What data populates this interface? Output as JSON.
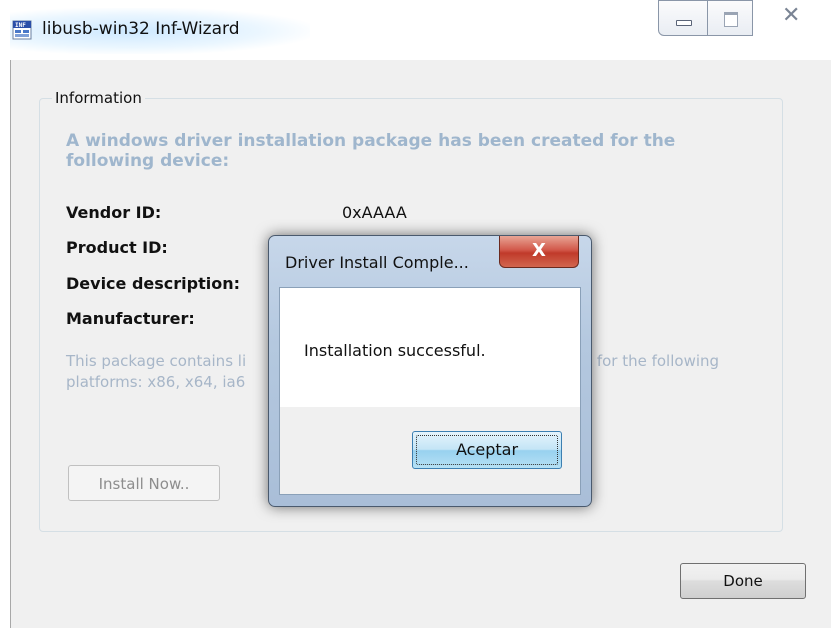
{
  "window": {
    "title": "libusb-win32 Inf-Wizard",
    "icon": "inf-file-icon"
  },
  "group": {
    "legend": "Information",
    "headline": "A windows driver installation package has been created for the following device:",
    "rows": [
      {
        "label": "Vendor ID:",
        "value": "0xAAAA"
      },
      {
        "label": "Product ID:",
        "value": ""
      },
      {
        "label": "Device description:",
        "value": ""
      },
      {
        "label": "Manufacturer:",
        "value": ""
      }
    ],
    "info_visible_left_line1": "This package contains li",
    "info_visible_left_line2": "platforms: x86, x64, ia6",
    "info_visible_right": "rt for the following"
  },
  "buttons": {
    "install": "Install Now..",
    "done": "Done"
  },
  "dialog": {
    "title": "Driver Install Comple...",
    "close_glyph": "X",
    "message": "Installation successful.",
    "ok": "Aceptar"
  },
  "controls": {
    "close_glyph": "✕"
  },
  "colors": {
    "headline": "#9fb6cd",
    "info_text": "#a7b6c8",
    "dialog_close": "#c03a2a"
  }
}
